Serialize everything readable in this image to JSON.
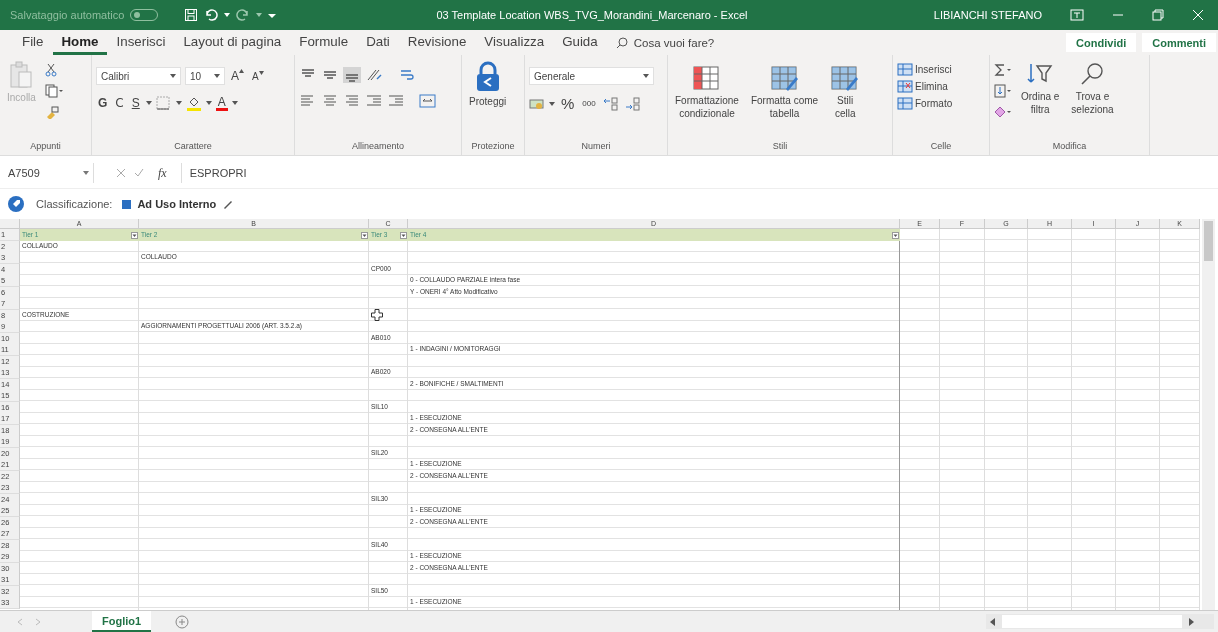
{
  "title_bar": {
    "autosave_label": "Salvataggio automatico",
    "autosave_on": false,
    "title": "03 Template Location WBS_TVG_Morandini_Marcenaro  -  Excel",
    "user": "LIBIANCHI STEFANO"
  },
  "menu_tabs": [
    {
      "label": "File",
      "selected": false
    },
    {
      "label": "Home",
      "selected": true
    },
    {
      "label": "Inserisci",
      "selected": false
    },
    {
      "label": "Layout di pagina",
      "selected": false
    },
    {
      "label": "Formule",
      "selected": false
    },
    {
      "label": "Dati",
      "selected": false
    },
    {
      "label": "Revisione",
      "selected": false
    },
    {
      "label": "Visualizza",
      "selected": false
    },
    {
      "label": "Guida",
      "selected": false
    }
  ],
  "search": {
    "placeholder": "Cosa vuoi fare?"
  },
  "share_buttons": [
    "Condividi",
    "Commenti"
  ],
  "ribbon": {
    "groups": [
      {
        "kind": "clipboard",
        "label": "Appunti",
        "paste": "Incolla",
        "paste_disabled": true
      },
      {
        "kind": "font",
        "label": "Carattere",
        "font": "Calibri",
        "size": "10",
        "grow": "A",
        "shrink": "A",
        "bold": "G",
        "italic": "C",
        "underline": "S",
        "font_color": "A"
      },
      {
        "kind": "alignment",
        "label": "Allineamento"
      },
      {
        "kind": "protection",
        "label": "Protezione",
        "button": "Proteggi"
      },
      {
        "kind": "number",
        "label": "Numeri",
        "format": "Generale",
        "percent": "%",
        "thousands": "000"
      },
      {
        "kind": "styles",
        "label": "Stili",
        "buttons": [
          "Formattazione\ncondizionale",
          "Formatta come\ntabella",
          "Stili\ncella"
        ]
      },
      {
        "kind": "cells",
        "label": "Celle",
        "buttons": [
          "Inserisci",
          "Elimina",
          "Formato"
        ]
      },
      {
        "kind": "editing",
        "label": "Modifica",
        "buttons": [
          "Ordina e\nfiltra",
          "Trova e\nseleziona"
        ]
      }
    ]
  },
  "formula_bar": {
    "name_box": "A7509",
    "fx": "fx",
    "value": "ESPROPRI"
  },
  "classification": {
    "label": "Classificazione:",
    "value": "Ad Uso Interno"
  },
  "sheet": {
    "columns": [
      "A",
      "B",
      "C",
      "D",
      "E",
      "F",
      "G",
      "H",
      "I",
      "J",
      "K"
    ],
    "header_row": "1",
    "headers": [
      "Tier 1",
      "Tier 2",
      "Tier 3",
      "Tier 4"
    ],
    "rows": [
      {
        "n": "2",
        "a": "COLLAUDO"
      },
      {
        "n": "3",
        "b": "COLLAUDO"
      },
      {
        "n": "4",
        "c": "CP000"
      },
      {
        "n": "5",
        "d": "0 - COLLAUDO PARZIALE intera fase"
      },
      {
        "n": "6",
        "d": "Y - ONERI 4° Atto Modificativo"
      },
      {
        "n": "7"
      },
      {
        "n": "8",
        "a": "COSTRUZIONE",
        "pointer": true
      },
      {
        "n": "9",
        "b": "AGGIORNAMENTI PROGETTUALI 2006 (ART. 3.5.2.a)"
      },
      {
        "n": "10",
        "c": "AB010"
      },
      {
        "n": "11",
        "d": "1 - INDAGINI / MONITORAGGI"
      },
      {
        "n": "12"
      },
      {
        "n": "13",
        "c": "AB020"
      },
      {
        "n": "14",
        "d": "2 - BONIFICHE / SMALTIMENTI"
      },
      {
        "n": "15"
      },
      {
        "n": "16",
        "c": "SIL10"
      },
      {
        "n": "17",
        "d": "1 - ESECUZIONE"
      },
      {
        "n": "18",
        "d": "2 - CONSEGNA ALL'ENTE"
      },
      {
        "n": "19"
      },
      {
        "n": "20",
        "c": "SIL20"
      },
      {
        "n": "21",
        "d": "1 - ESECUZIONE"
      },
      {
        "n": "22",
        "d": "2 - CONSEGNA ALL'ENTE"
      },
      {
        "n": "23"
      },
      {
        "n": "24",
        "c": "SIL30"
      },
      {
        "n": "25",
        "d": "1 - ESECUZIONE"
      },
      {
        "n": "26",
        "d": "2 - CONSEGNA ALL'ENTE"
      },
      {
        "n": "27"
      },
      {
        "n": "28",
        "c": "SIL40"
      },
      {
        "n": "29",
        "d": "1 - ESECUZIONE"
      },
      {
        "n": "30",
        "d": "2 - CONSEGNA ALL'ENTE"
      },
      {
        "n": "31"
      },
      {
        "n": "32",
        "c": "SIL50"
      },
      {
        "n": "33",
        "d": "1 - ESECUZIONE"
      }
    ]
  },
  "sheet_tabs": [
    {
      "label": "Foglio1",
      "selected": true
    }
  ]
}
